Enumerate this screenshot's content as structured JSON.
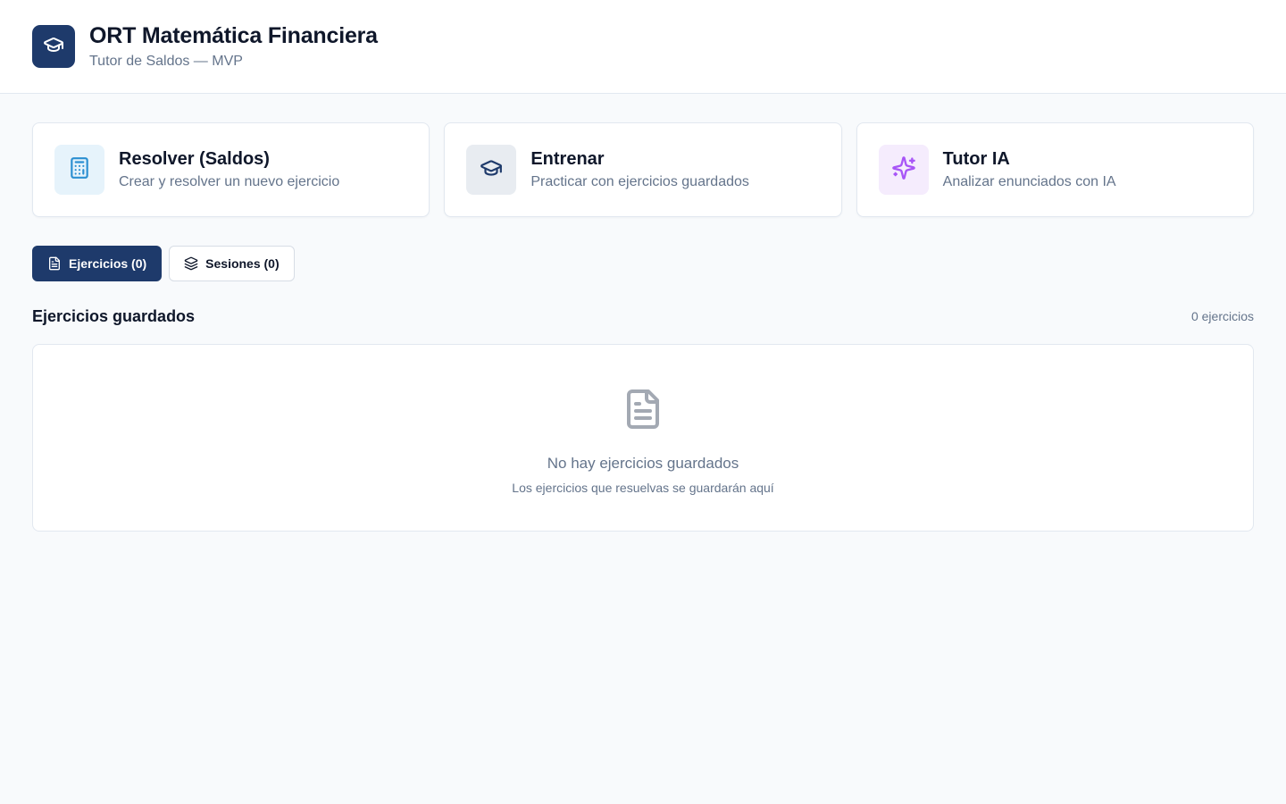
{
  "header": {
    "logo_icon": "graduation-cap-icon",
    "title": "ORT Matemática Financiera",
    "subtitle": "Tutor de Saldos — MVP"
  },
  "cards": [
    {
      "icon": "calculator-icon",
      "icon_bg": "#e6f3fb",
      "icon_color": "#2b8fd1",
      "title": "Resolver (Saldos)",
      "description": "Crear y resolver un nuevo ejercicio"
    },
    {
      "icon": "graduation-cap-icon",
      "icon_bg": "#e8ecf1",
      "icon_color": "#1e3a6b",
      "title": "Entrenar",
      "description": "Practicar con ejercicios guardados"
    },
    {
      "icon": "sparkles-icon",
      "icon_bg": "#f5ecfd",
      "icon_color": "#a855f7",
      "title": "Tutor IA",
      "description": "Analizar enunciados con IA"
    }
  ],
  "tabs": [
    {
      "icon": "file-text-icon",
      "label": "Ejercicios (0)",
      "active": true
    },
    {
      "icon": "layers-icon",
      "label": "Sesiones (0)",
      "active": false
    }
  ],
  "section": {
    "title": "Ejercicios guardados",
    "count": "0 ejercicios"
  },
  "empty_state": {
    "icon": "file-text-icon",
    "title": "No hay ejercicios guardados",
    "description": "Los ejercicios que resuelvas se guardarán aquí"
  },
  "colors": {
    "primary": "#1e3a6b",
    "background": "#f8fafc",
    "muted_text": "#64748b",
    "border": "#e2e8f0"
  }
}
